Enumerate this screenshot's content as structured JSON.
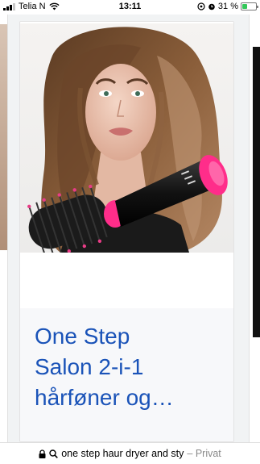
{
  "status_bar": {
    "carrier": "Telia N",
    "time": "13:11",
    "battery": "31 %",
    "battery_level": 0.31,
    "icons": [
      "signal-icon",
      "wifi-icon",
      "location-icon",
      "alarm-icon",
      "battery-icon"
    ]
  },
  "card": {
    "image_name": "hair-styler-model-image",
    "title_lines": [
      "One Step",
      "Salon 2-i-1",
      "hårføner og…"
    ]
  },
  "url_bar": {
    "query": "one step haur dryer and sty",
    "mode": "– Privat"
  },
  "colors": {
    "link_blue": "#1a53b8",
    "battery_green": "#34c759",
    "brush_pink": "#ff2d8a",
    "caption_bg": "#f7f8fa"
  }
}
